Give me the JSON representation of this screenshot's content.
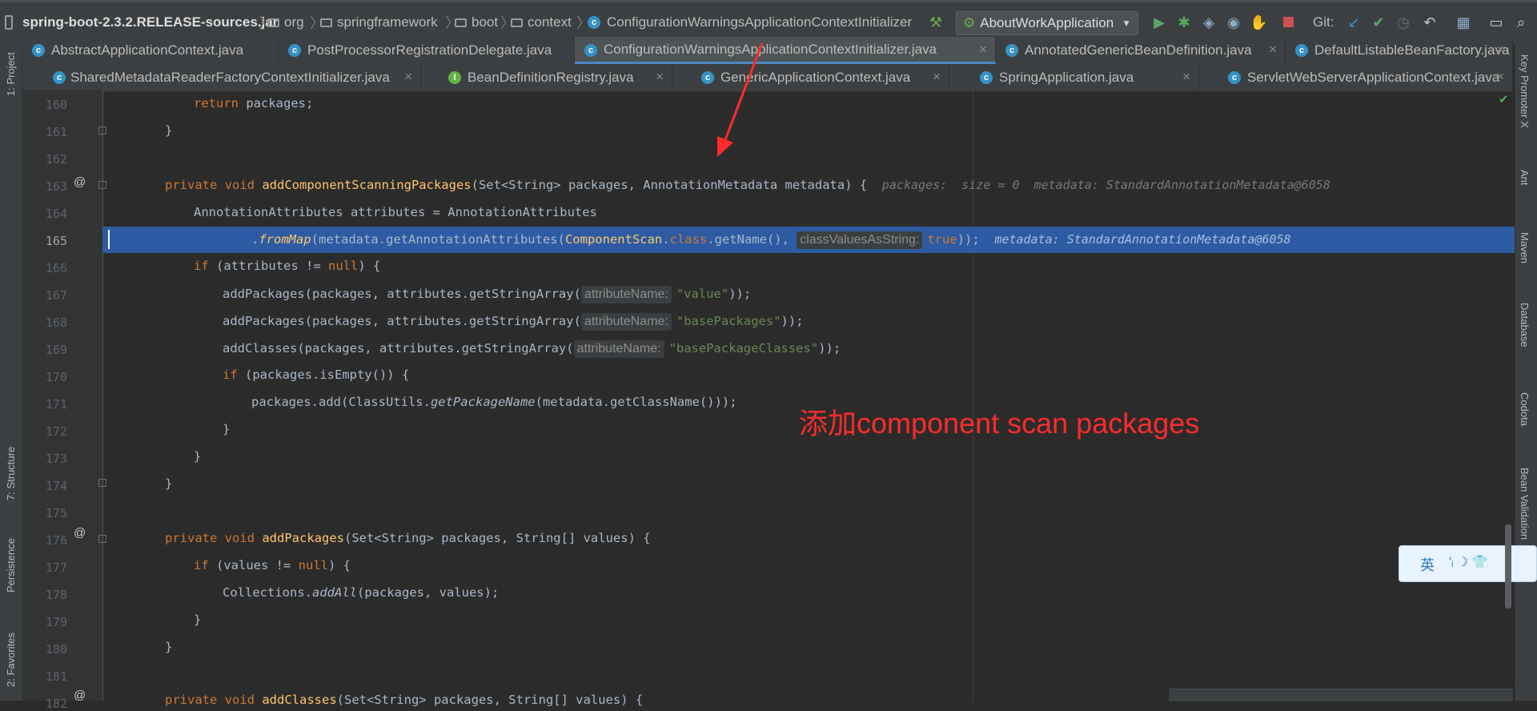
{
  "breadcrumbs": {
    "jar": "spring-boot-2.3.2.RELEASE-sources.jar",
    "p1": "org",
    "p2": "springframework",
    "p3": "boot",
    "p4": "context",
    "cls": "ConfigurationWarningsApplicationContextInitializer"
  },
  "run_config": {
    "label": "AboutWorkApplication"
  },
  "git": {
    "label": "Git:"
  },
  "tabs_row1": [
    {
      "label": "AbstractApplicationContext.java",
      "icon": "class-icon"
    },
    {
      "label": "PostProcessorRegistrationDelegate.java",
      "icon": "class-icon"
    },
    {
      "label": "ConfigurationWarningsApplicationContextInitializer.java",
      "icon": "class-icon",
      "active": true
    },
    {
      "label": "AnnotatedGenericBeanDefinition.java",
      "icon": "class-icon"
    },
    {
      "label": "DefaultListableBeanFactory.java",
      "icon": "class-icon"
    }
  ],
  "tabs_row2": [
    {
      "label": "SharedMetadataReaderFactoryContextInitializer.java",
      "icon": "class-icon"
    },
    {
      "label": "BeanDefinitionRegistry.java",
      "icon": "interface-icon"
    },
    {
      "label": "GenericApplicationContext.java",
      "icon": "class-icon"
    },
    {
      "label": "SpringApplication.java",
      "icon": "class-icon"
    },
    {
      "label": "ServletWebServerApplicationContext.java",
      "icon": "class-icon"
    }
  ],
  "left_tools": [
    "1: Project",
    "7: Structure",
    "Persistence",
    "2: Favorites"
  ],
  "right_tools": [
    "Key Promoter X",
    "Ant",
    "Maven",
    "Database",
    "Codota",
    "Bean Validation"
  ],
  "line_numbers": [
    "160",
    "161",
    "162",
    "163",
    "164",
    "165",
    "166",
    "167",
    "168",
    "169",
    "170",
    "171",
    "172",
    "173",
    "174",
    "175",
    "176",
    "177",
    "178",
    "179",
    "180",
    "181",
    "182"
  ],
  "code": {
    "l160": {
      "kw": "return",
      "rest": " packages;"
    },
    "l161": {
      "text": "}"
    },
    "l163": {
      "mods": "private void ",
      "name": "addComponentScanningPackages",
      "params": "(Set<String> packages, AnnotationMetadata metadata) {",
      "dbg": "packages:  size = 0  metadata: StandardAnnotationMetadata@6058"
    },
    "l164": {
      "text": "AnnotationAttributes attributes = AnnotationAttributes"
    },
    "l165": {
      "dot": ".",
      "method": "fromMap",
      "a": "(metadata.getAnnotationAttributes(",
      "cls": "ComponentScan",
      "b": ".",
      "kw_class": "class",
      "c": ".getName(), ",
      "hint": "classValuesAsString:",
      "kw_true": "true",
      "d": "));",
      "dbg": "metadata: StandardAnnotationMetadata@6058"
    },
    "l166": {
      "kw": "if",
      "rest": " (attributes != ",
      "null": "null",
      "end": ") {"
    },
    "l167": {
      "a": "addPackages(packages, attributes.getStringArray(",
      "hint": "attributeName:",
      "str": "\"value\"",
      "b": "));"
    },
    "l168": {
      "a": "addPackages(packages, attributes.getStringArray(",
      "hint": "attributeName:",
      "str": "\"basePackages\"",
      "b": "));"
    },
    "l169": {
      "a": "addClasses(packages, attributes.getStringArray(",
      "hint": "attributeName:",
      "str": "\"basePackageClasses\"",
      "b": "));"
    },
    "l170": {
      "kw": "if",
      "rest": " (packages.isEmpty()) {"
    },
    "l171": {
      "a": "packages.add(ClassUtils.",
      "it": "getPackageName",
      "b": "(metadata.getClassName()));"
    },
    "l172": {
      "text": "}"
    },
    "l173": {
      "text": "}"
    },
    "l174": {
      "text": "}"
    },
    "l176": {
      "mods": "private void ",
      "name": "addPackages",
      "params": "(Set<String> packages, String[] values) {"
    },
    "l177": {
      "kw": "if",
      "rest": " (values != ",
      "null": "null",
      "end": ") {"
    },
    "l178": {
      "a": "Collections.",
      "it": "addAll",
      "b": "(packages, values);"
    },
    "l179": {
      "text": "}"
    },
    "l180": {
      "text": "}"
    },
    "l182": {
      "mods": "private void ",
      "name": "addClasses",
      "params": "(Set<String> packages, String[] values) {"
    }
  },
  "annotation": {
    "text": "添加component scan packages",
    "color": "#ff2b2b"
  },
  "ime": {
    "lang": "英",
    "symbols": "'ᵢ ☽ 👕"
  },
  "colors": {
    "highlight": "#2d5ba3",
    "background": "#2b2b2b",
    "keyword": "#cc7832",
    "method": "#ffc66d",
    "string": "#6a8759"
  }
}
